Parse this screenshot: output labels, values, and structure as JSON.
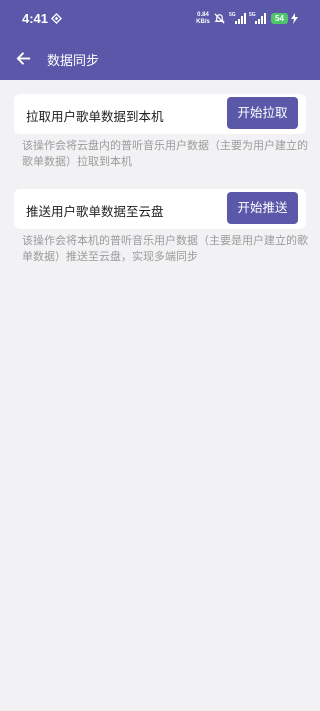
{
  "status_bar": {
    "time": "4:41",
    "net_speed_value": "0.84",
    "net_speed_unit": "KB/s",
    "sim1_tag": "5G",
    "sim2_tag": "5G",
    "battery": "54"
  },
  "header": {
    "title": "数据同步"
  },
  "sync": {
    "pull": {
      "label": "拉取用户歌单数据到本机",
      "button": "开始拉取",
      "description": "该操作会将云盘内的普听音乐用户数据（主要为用户建立的歌单数据）拉取到本机"
    },
    "push": {
      "label": "推送用户歌单数据至云盘",
      "button": "开始推送",
      "description": "该操作会将本机的普听音乐用户数据（主要是用户建立的歌单数据）推送至云盘，实现多端同步"
    }
  },
  "colors": {
    "primary": "#5b58aa",
    "background": "#f2f2f4",
    "hint_text": "#9b9b9b"
  }
}
